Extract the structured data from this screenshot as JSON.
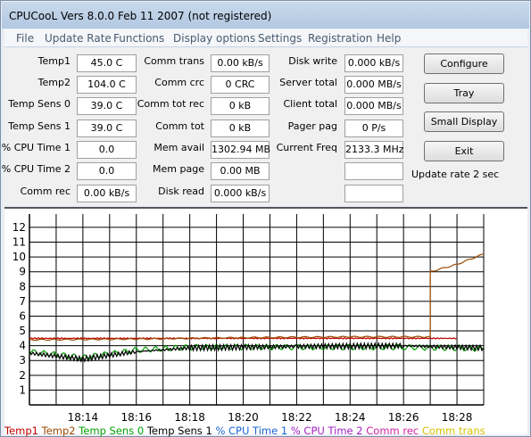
{
  "window": {
    "title": "CPUCooL  Vers 8.0.0  Feb 11 2007 (not registered)"
  },
  "menu": [
    "File",
    "Update Rate",
    "Functions",
    "Display options",
    "Settings",
    "Registration",
    "Help"
  ],
  "col1": [
    {
      "label": "Temp1",
      "value": "45.0 C"
    },
    {
      "label": "Temp2",
      "value": "104.0 C"
    },
    {
      "label": "Temp Sens 0",
      "value": "39.0 C"
    },
    {
      "label": "Temp Sens 1",
      "value": "39.0 C"
    },
    {
      "label": "% CPU Time 1",
      "value": "0.0"
    },
    {
      "label": "% CPU Time 2",
      "value": "0.0"
    },
    {
      "label": "Comm rec",
      "value": "0.00 kB/s"
    }
  ],
  "col2": [
    {
      "label": "Comm trans",
      "value": "0.00 kB/s"
    },
    {
      "label": "Comm crc",
      "value": "0 CRC"
    },
    {
      "label": "Comm tot rec",
      "value": "0 kB"
    },
    {
      "label": "Comm tot",
      "value": "0 kB"
    },
    {
      "label": "Mem avail",
      "value": "1302.94 MB"
    },
    {
      "label": "Mem page",
      "value": "0.00 MB"
    },
    {
      "label": "Disk read",
      "value": "0.000 kB/s"
    }
  ],
  "col3": [
    {
      "label": "Disk write",
      "value": "0.000 kB/s"
    },
    {
      "label": "Server total",
      "value": "0.000 MB/s"
    },
    {
      "label": "Client total",
      "value": "0.000 MB/s"
    },
    {
      "label": "Pager pag",
      "value": "0 P/s"
    },
    {
      "label": "Current Freq",
      "value": "2133.3 MHz"
    },
    {
      "label": "",
      "value": ""
    },
    {
      "label": "",
      "value": ""
    }
  ],
  "buttons": {
    "configure": "Configure",
    "tray": "Tray",
    "small_display": "Small Display",
    "exit": "Exit"
  },
  "update_rate_text": "Update rate 2 sec",
  "chart_data": {
    "type": "line",
    "y_ticks": [
      "1",
      "2",
      "3",
      "4",
      "5",
      "6",
      "7",
      "8",
      "9",
      "10",
      "11",
      "12"
    ],
    "ylim": [
      0,
      12.9
    ],
    "x_ticks": [
      "18:14",
      "18:16",
      "18:18",
      "18:20",
      "18:22",
      "18:24",
      "18:26",
      "18:28"
    ],
    "x_start": "18:12",
    "x_end": "18:29",
    "grid": true,
    "series": [
      {
        "name": "Temp1",
        "color": "#c00000",
        "x": [
          "18:12",
          "18:16",
          "18:20",
          "18:24",
          "18:28"
        ],
        "values": [
          4.5,
          4.5,
          4.5,
          4.5,
          4.5
        ]
      },
      {
        "name": "Temp2",
        "color": "#9a4b00",
        "x": [
          "18:12",
          "18:16",
          "18:20",
          "18:24",
          "18:27",
          "18:27",
          "18:28",
          "18:29"
        ],
        "values": [
          4.4,
          4.45,
          4.55,
          4.6,
          4.6,
          9.0,
          9.5,
          10.2
        ]
      },
      {
        "name": "Temp Sens 0",
        "color": "#00a000",
        "x": [
          "18:12",
          "18:14",
          "18:16",
          "18:18",
          "18:22",
          "18:26",
          "18:29"
        ],
        "values": [
          3.6,
          3.2,
          3.7,
          3.9,
          3.9,
          3.9,
          3.8
        ]
      },
      {
        "name": "Temp Sens 1",
        "color": "#000000",
        "x": [
          "18:12",
          "18:14",
          "18:16",
          "18:18",
          "18:22",
          "18:26",
          "18:29"
        ],
        "values": [
          3.5,
          3.1,
          3.6,
          3.85,
          3.95,
          4.0,
          3.85
        ]
      }
    ],
    "legend": [
      {
        "text": "Temp1",
        "color": "#c00000"
      },
      {
        "text": "Temp2",
        "color": "#9a4b00"
      },
      {
        "text": "Temp Sens 0",
        "color": "#00a000"
      },
      {
        "text": "Temp Sens 1",
        "color": "#000000"
      },
      {
        "text": "% CPU Time 1",
        "color": "#1a64d6"
      },
      {
        "text": "% CPU Time 2",
        "color": "#a020c0"
      },
      {
        "text": "Comm rec",
        "color": "#d020a0"
      },
      {
        "text": "Comm trans",
        "color": "#d8c000"
      }
    ]
  }
}
